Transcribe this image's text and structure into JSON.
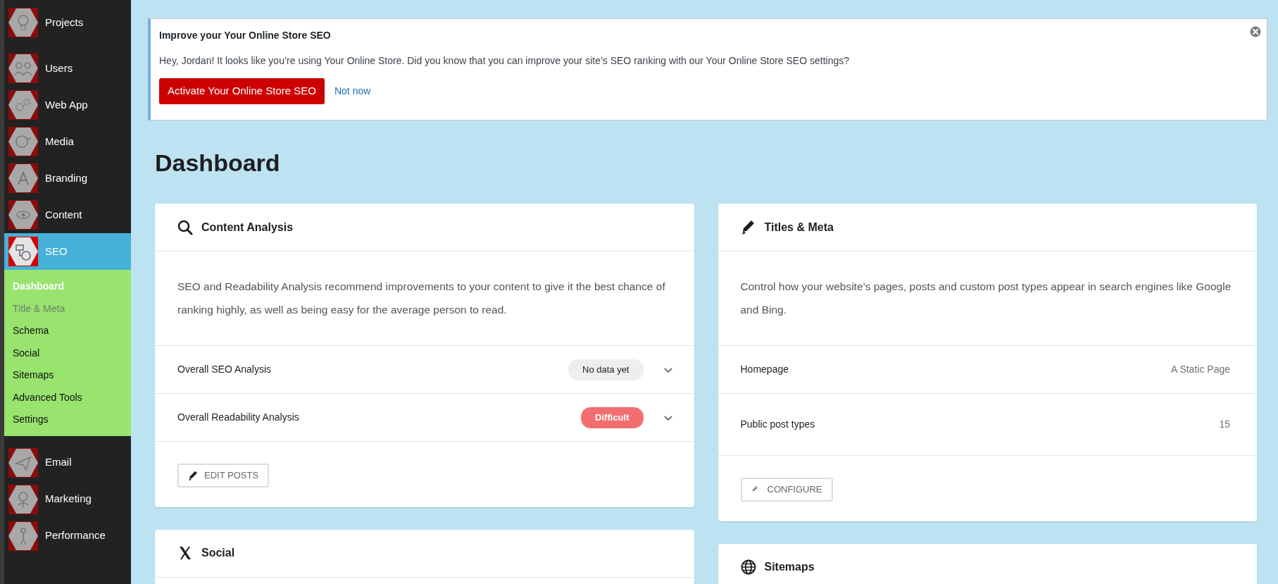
{
  "sidebar": {
    "items": [
      {
        "label": "Projects",
        "selected": false
      },
      {
        "label": "Users",
        "selected": false
      },
      {
        "label": "Web App",
        "selected": false
      },
      {
        "label": "Media",
        "selected": false
      },
      {
        "label": "Branding",
        "selected": false
      },
      {
        "label": "Content",
        "selected": false
      },
      {
        "label": "SEO",
        "selected": true,
        "children": [
          {
            "label": "Dashboard",
            "selected": true,
            "disabled": false
          },
          {
            "label": "Title & Meta",
            "selected": false,
            "disabled": true
          },
          {
            "label": "Schema",
            "selected": false,
            "disabled": false
          },
          {
            "label": "Social",
            "selected": false,
            "disabled": false
          },
          {
            "label": "Sitemaps",
            "selected": false,
            "disabled": false
          },
          {
            "label": "Advanced Tools",
            "selected": false,
            "disabled": false
          },
          {
            "label": "Settings",
            "selected": false,
            "disabled": false
          }
        ]
      },
      {
        "label": "Email",
        "selected": false
      },
      {
        "label": "Marketing",
        "selected": false
      },
      {
        "label": "Performance",
        "selected": false
      }
    ]
  },
  "notice": {
    "title": "Improve your Your Online Store SEO",
    "message": "Hey, Jordan! It looks like you’re using Your Online Store. Did you know that you can improve your site’s SEO ranking with our Your Online Store SEO settings?",
    "primary_button": "Activate Your Online Store SEO",
    "secondary_link": "Not now"
  },
  "page_title": "Dashboard",
  "columns": [
    {
      "cards": [
        {
          "title": "Content Analysis",
          "description": "SEO and Readability Analysis recommend improvements to your content to give it the best chance of ranking highly, as well as being easy for the average person to read.",
          "rows": [
            {
              "kind": "badge",
              "label": "Overall SEO Analysis",
              "badge": "No data yet",
              "color": "#eeeeee",
              "expanded": false
            },
            {
              "kind": "badge",
              "label": "Overall Readability Analysis",
              "badge": "Difficult",
              "color": "#f36f6f",
              "expanded": false
            }
          ],
          "button": {
            "label": "EDIT POSTS"
          }
        },
        {
          "title": "Social"
        }
      ]
    },
    {
      "cards": [
        {
          "title": "Titles & Meta",
          "description": "Control how your website’s pages, posts and custom post types appear in search engines like Google and Bing.",
          "rows": [
            {
              "kind": "value",
              "label": "Homepage",
              "value": "A Static Page"
            },
            {
              "kind": "value",
              "label": "Public post types",
              "value": "15"
            }
          ],
          "button": {
            "label": "CONFIGURE"
          }
        },
        {
          "title": "Sitemaps"
        }
      ]
    }
  ]
}
